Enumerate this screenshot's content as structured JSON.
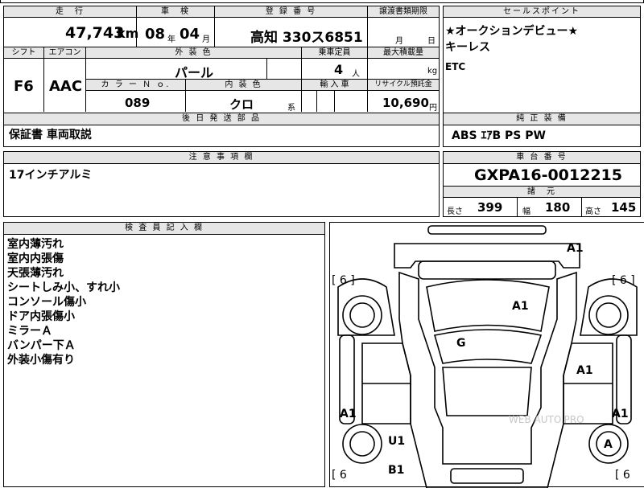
{
  "top": {
    "mileage_label": "走　行",
    "mileage_value": "47,743",
    "mileage_unit": "km",
    "inspection_label": "車　検",
    "inspection_year": "08",
    "inspection_year_unit": "年",
    "inspection_month": "04",
    "inspection_month_unit": "月",
    "registration_label": "登 録 番 号",
    "registration_value": "高知 330ス6851",
    "transfer_label": "譲渡書類期限",
    "transfer_month_unit": "月",
    "transfer_day_unit": "日"
  },
  "row2": {
    "shift_label": "シフト",
    "shift_value": "F6",
    "aircon_label": "エアコン",
    "aircon_value": "AAC",
    "exterior_label": "外 装 色",
    "exterior_value": "パール",
    "capacity_label": "乗車定員",
    "capacity_value": "4",
    "capacity_unit": "人",
    "maxload_label": "最大積載量",
    "maxload_unit": "kg",
    "color_no_label": "カ ラ ー Ｎ ｏ.",
    "color_no_value": "089",
    "interior_label": "内 装 色",
    "interior_value": "クロ",
    "interior_unit": "系",
    "import_label": "輸 入 車",
    "recycle_label": "リサイクル預託金",
    "recycle_value": "10,690",
    "recycle_unit": "円"
  },
  "later_parts": {
    "label": "後 日 発 送 部 品",
    "value": "保証書 車両取説"
  },
  "notes": {
    "label": "注 意 事 項 欄",
    "value": "17インチアルミ"
  },
  "sales_points": {
    "label": "セールスポイント",
    "lines": [
      "★オークションデビュー★",
      "キーレス",
      "ETC"
    ]
  },
  "equipment": {
    "label": "純 正 装 備",
    "value": "ABS ｴｱB PS PW"
  },
  "chassis": {
    "label": "車 台 番 号",
    "value": "GXPA16-0012215"
  },
  "dimensions": {
    "label": "諸　元",
    "length_label": "長さ",
    "length_value": "399",
    "width_label": "幅",
    "width_value": "180",
    "height_label": "高さ",
    "height_value": "145"
  },
  "inspector": {
    "label": "検 査 員 記 入 欄",
    "lines": [
      "室内薄汚れ",
      "室内内張傷",
      "天張薄汚れ",
      "シートしみ小、すれ小",
      "コンソール傷小",
      "ドア内張傷小",
      "ミラーＡ",
      "バンパー下Ａ",
      "外装小傷有り"
    ]
  },
  "diagram": {
    "tire_tl": "[ 6 ]",
    "tire_tr": "[ 6 ]",
    "tire_bl": "[ 6",
    "tire_br": "[ 6",
    "marks": {
      "front_right": "A1",
      "hood": "A1",
      "roof": "G",
      "right_door": "A1",
      "left_side": "A1",
      "right_side": "A1",
      "rear_left": "U1",
      "rear_right_wheel": "A",
      "rear": "B1"
    },
    "watermark": "WEB AUTO.PRO"
  }
}
